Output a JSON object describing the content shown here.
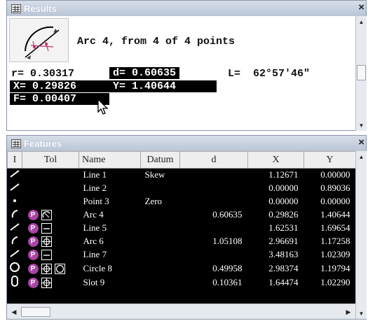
{
  "results": {
    "title": "Results",
    "close": "×",
    "arc_icon": "arc-measure-icon",
    "heading": "Arc 4, from 4 of 4 points",
    "r": "r= 0.30317",
    "x": "X= 0.29826",
    "f": "F= 0.00407",
    "d": "d= 0.60635",
    "y": "Y= 1.40644",
    "l": "L=  62°57'46\""
  },
  "features": {
    "title": "Features",
    "close": "×",
    "columns": [
      "I",
      "Tol",
      "Name",
      "Datum",
      "d",
      "X",
      "Y"
    ],
    "rows": [
      {
        "icon": "line-icon",
        "p": false,
        "sym": [],
        "name": "Line 1",
        "datum": "Skew",
        "d": "",
        "x": "1.12671",
        "y": "0.00000"
      },
      {
        "icon": "line-icon",
        "p": false,
        "sym": [],
        "name": "Line 2",
        "datum": "",
        "d": "",
        "x": "0.00000",
        "y": "0.89036"
      },
      {
        "icon": "point-icon",
        "p": false,
        "sym": [],
        "name": "Point 3",
        "datum": "Zero",
        "d": "",
        "x": "0.00000",
        "y": "0.00000"
      },
      {
        "icon": "arc-icon",
        "p": true,
        "sym": [
          "profile"
        ],
        "name": "Arc 4",
        "datum": "",
        "d": "0.60635",
        "x": "0.29826",
        "y": "1.40644"
      },
      {
        "icon": "line-icon",
        "p": true,
        "sym": [
          "straight"
        ],
        "name": "Line 5",
        "datum": "",
        "d": "",
        "x": "1.62531",
        "y": "1.69654"
      },
      {
        "icon": "arc-icon",
        "p": true,
        "sym": [
          "position"
        ],
        "name": "Arc 6",
        "datum": "",
        "d": "1.05108",
        "x": "2.96691",
        "y": "1.17258"
      },
      {
        "icon": "line-icon",
        "p": true,
        "sym": [
          "straight"
        ],
        "name": "Line 7",
        "datum": "",
        "d": "",
        "x": "3.48163",
        "y": "1.02309"
      },
      {
        "icon": "circle-icon",
        "p": true,
        "sym": [
          "position",
          "circularity"
        ],
        "name": "Circle 8",
        "datum": "",
        "d": "0.49958",
        "x": "2.98374",
        "y": "1.19794"
      },
      {
        "icon": "slot-icon",
        "p": true,
        "sym": [
          "position"
        ],
        "name": "Slot 9",
        "datum": "",
        "d": "0.10361",
        "x": "1.64474",
        "y": "1.02290"
      }
    ]
  },
  "colors": {
    "tol_badge": "#a944a4",
    "grid_bg": "#000000",
    "titlebar": "#c9d3e0"
  },
  "p_badge": "P"
}
